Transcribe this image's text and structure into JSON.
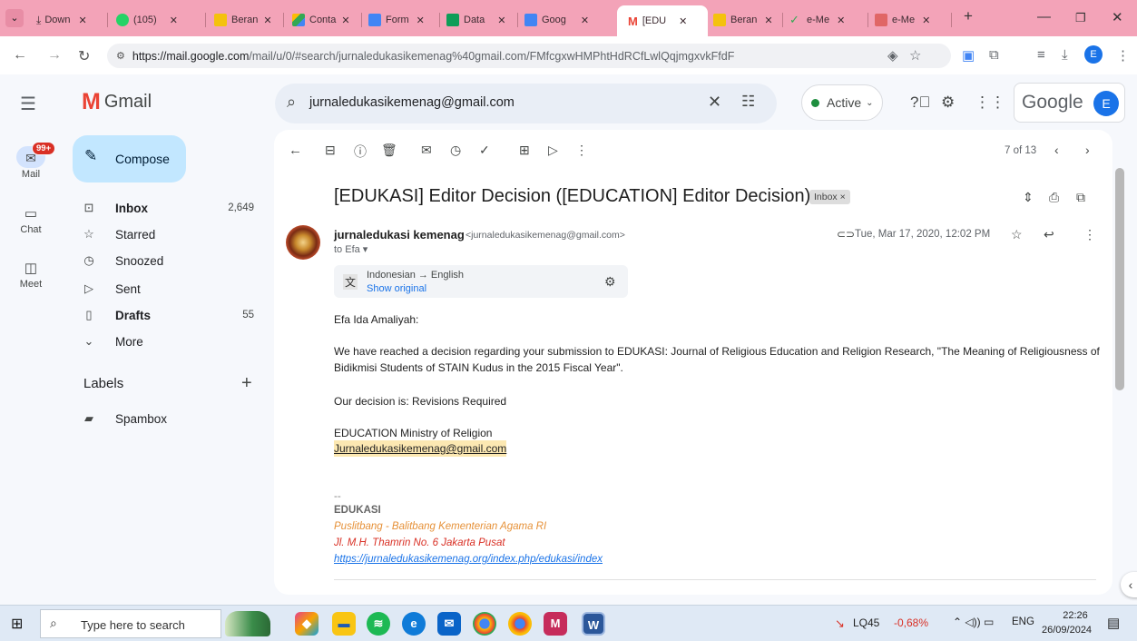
{
  "browser": {
    "tabs": [
      {
        "label": "Down",
        "icon": "download-icon",
        "color": "#5f6368"
      },
      {
        "label": "(105)",
        "icon": "whatsapp-icon",
        "color": "#25d366"
      },
      {
        "label": "Beran",
        "icon": "ojs-icon",
        "color": "#f4c20d"
      },
      {
        "label": "Conta",
        "icon": "drive-icon",
        "color": "#34a853"
      },
      {
        "label": "Form",
        "icon": "forms-icon",
        "color": "#4285f4"
      },
      {
        "label": "Data",
        "icon": "sheets-icon",
        "color": "#0f9d58"
      },
      {
        "label": "Goog",
        "icon": "docs-icon",
        "color": "#4285f4"
      },
      {
        "label": "[EDU",
        "icon": "gmail-icon",
        "color": "#ea4335"
      },
      {
        "label": "Beran",
        "icon": "ojs-icon",
        "color": "#f4c20d"
      },
      {
        "label": "e-Me",
        "icon": "check-icon",
        "color": "#34a853"
      },
      {
        "label": "e-Me",
        "icon": "grid-icon",
        "color": "#e06666"
      }
    ],
    "url": "https://mail.google.com/mail/u/0/#search/jurnaledukasikemenag%40gmail.com/FMfcgxwHMPhtHdRCfLwlQqjmgxvkFfdF",
    "url_host": "https://mail.google.com",
    "url_rest": "/mail/u/0/#search/jurnaledukasikemenag%40gmail.com/FMfcgxwHMPhtHdRCfLwlQqjmgxvkFfdF",
    "profile_initial": "E"
  },
  "gmail": {
    "app_name": "Gmail",
    "search_query": "jurnaledukasikemenag@gmail.com",
    "status": "Active",
    "account_brand": "Google",
    "account_initial": "E"
  },
  "rail": {
    "mail_badge": "99+",
    "items": [
      {
        "label": "Mail"
      },
      {
        "label": "Chat"
      },
      {
        "label": "Meet"
      }
    ]
  },
  "sidebar": {
    "compose": "Compose",
    "items": [
      {
        "label": "Inbox",
        "count": "2,649",
        "icon": "inbox-icon",
        "bold": true
      },
      {
        "label": "Starred",
        "count": "",
        "icon": "star-icon",
        "bold": false
      },
      {
        "label": "Snoozed",
        "count": "",
        "icon": "clock-icon",
        "bold": false
      },
      {
        "label": "Sent",
        "count": "",
        "icon": "send-icon",
        "bold": false
      },
      {
        "label": "Drafts",
        "count": "55",
        "icon": "draft-icon",
        "bold": true
      },
      {
        "label": "More",
        "count": "",
        "icon": "chevron-down-icon",
        "bold": false
      }
    ],
    "labels_title": "Labels",
    "labels": [
      {
        "label": "Spambox"
      }
    ]
  },
  "message": {
    "pager": "7 of 13",
    "subject": "[EDUKASI] Editor Decision ([EDUCATION] Editor Decision)",
    "label_chip": "Inbox ×",
    "sender_name": "jurnaledukasi kemenag",
    "sender_email": "<jurnaledukasikemenag@gmail.com>",
    "to_line": "to Efa ▾",
    "date": "Tue, Mar 17, 2020, 12:02 PM",
    "translate_langs": "Indonesian → English",
    "translate_show": "Show original",
    "greeting": "Efa Ida Amaliyah:",
    "para1": "We have reached a decision regarding your submission to EDUKASI: Journal of Religious Education and Religion Research, \"The Meaning of Religiousness of Bidikmisi Students of STAIN Kudus in the 2015 Fiscal Year\".",
    "decision": "Our decision is: Revisions Required",
    "signoff1": "EDUCATION Ministry of Religion",
    "signoff_email": "Jurnaledukasikemenag@gmail.com",
    "sig_dash": "--",
    "sig_name": "EDUKASI",
    "sig_line1": "Puslitbang - Balitbang Kementerian Agama RI",
    "sig_line2": "Jl. M.H. Thamrin No. 6 Jakarta Pusat",
    "sig_link": "https://jurnaledukasikemenag.org/index.php/edukasi/index"
  },
  "taskbar": {
    "search_placeholder": "Type here to search",
    "stock_name": "LQ45",
    "stock_change": "-0,68%",
    "lang": "ENG",
    "time": "22:26",
    "date": "26/09/2024"
  },
  "colors": {
    "tab_strip": "#f3a3b8",
    "compose_bg": "#c2e7ff",
    "active_dot": "#1e8e3e",
    "sig_orange": "#e69138",
    "sig_red": "#d93025",
    "link": "#1a73e8",
    "highlight": "#fce8b2"
  }
}
